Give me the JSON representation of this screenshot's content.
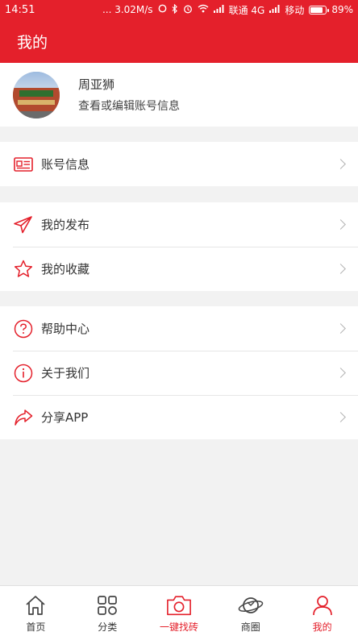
{
  "status_bar": {
    "time": "14:51",
    "speed": "... 3.02M/s",
    "carrier1": "联通 4G",
    "carrier2": "移动",
    "battery": "89%",
    "battery_level": 0.89
  },
  "header": {
    "title": "我的"
  },
  "profile": {
    "name": "周亚狮",
    "subtitle": "查看或编辑账号信息"
  },
  "menu": {
    "account": {
      "label": "账号信息",
      "icon": "id-card-icon"
    },
    "publish": {
      "label": "我的发布",
      "icon": "paper-plane-icon"
    },
    "favorites": {
      "label": "我的收藏",
      "icon": "star-icon"
    },
    "help": {
      "label": "帮助中心",
      "icon": "question-circle-icon"
    },
    "about": {
      "label": "关于我们",
      "icon": "info-circle-icon"
    },
    "share": {
      "label": "分享APP",
      "icon": "share-arrow-icon"
    }
  },
  "tabs": [
    {
      "label": "首页",
      "icon": "home-icon"
    },
    {
      "label": "分类",
      "icon": "grid-icon"
    },
    {
      "label": "一键找砖",
      "icon": "camera-icon"
    },
    {
      "label": "商圈",
      "icon": "planet-icon"
    },
    {
      "label": "我的",
      "icon": "user-icon"
    }
  ],
  "colors": {
    "accent": "#e4202b",
    "background": "#f2f2f2"
  }
}
